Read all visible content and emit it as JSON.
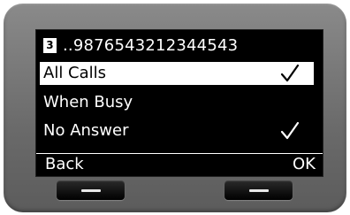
{
  "header": {
    "line_number": "3",
    "number": "..9876543212344543"
  },
  "menu": [
    {
      "label": "All Calls",
      "checked": true,
      "selected": true
    },
    {
      "label": "When Busy",
      "checked": false,
      "selected": false
    },
    {
      "label": "No Answer",
      "checked": true,
      "selected": false
    }
  ],
  "softkeys": {
    "left": "Back",
    "right": "OK"
  }
}
